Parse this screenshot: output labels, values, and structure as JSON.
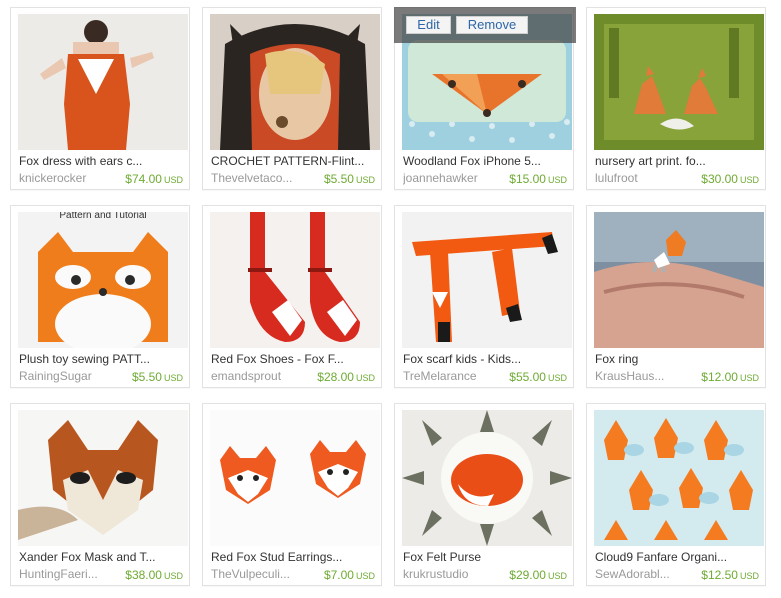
{
  "admin": {
    "edit_label": "Edit",
    "remove_label": "Remove"
  },
  "currency": "USD",
  "colors": {
    "price": "#6eab33",
    "title": "#333333",
    "shop": "#999999"
  },
  "items": [
    {
      "title": "Fox dress with ears c...",
      "shop": "knickerocker",
      "price": "$74.00"
    },
    {
      "title": "CROCHET PATTERN-Flint...",
      "shop": "Thevelvetaco...",
      "price": "$5.50"
    },
    {
      "title": "Woodland Fox iPhone 5...",
      "shop": "joannehawker",
      "price": "$15.00"
    },
    {
      "title": "nursery art print. fo...",
      "shop": "lulufroot",
      "price": "$30.00"
    },
    {
      "title": "Plush toy sewing PATT...",
      "shop": "RainingSugar",
      "price": "$5.50",
      "image_text": "Pattern and Tutorial"
    },
    {
      "title": "Red Fox Shoes - Fox F...",
      "shop": "emandsprout",
      "price": "$28.00"
    },
    {
      "title": "Fox scarf kids - Kids...",
      "shop": "TreMelarance",
      "price": "$55.00"
    },
    {
      "title": "Fox ring",
      "shop": "KrausHaus...",
      "price": "$12.00"
    },
    {
      "title": "Xander Fox Mask and T...",
      "shop": "HuntingFaeri...",
      "price": "$38.00"
    },
    {
      "title": "Red Fox Stud Earrings...",
      "shop": "TheVulpeculi...",
      "price": "$7.00"
    },
    {
      "title": "Fox Felt Purse",
      "shop": "krukrustudio",
      "price": "$29.00"
    },
    {
      "title": "Cloud9 Fanfare Organi...",
      "shop": "SewAdorabl...",
      "price": "$12.50"
    }
  ]
}
